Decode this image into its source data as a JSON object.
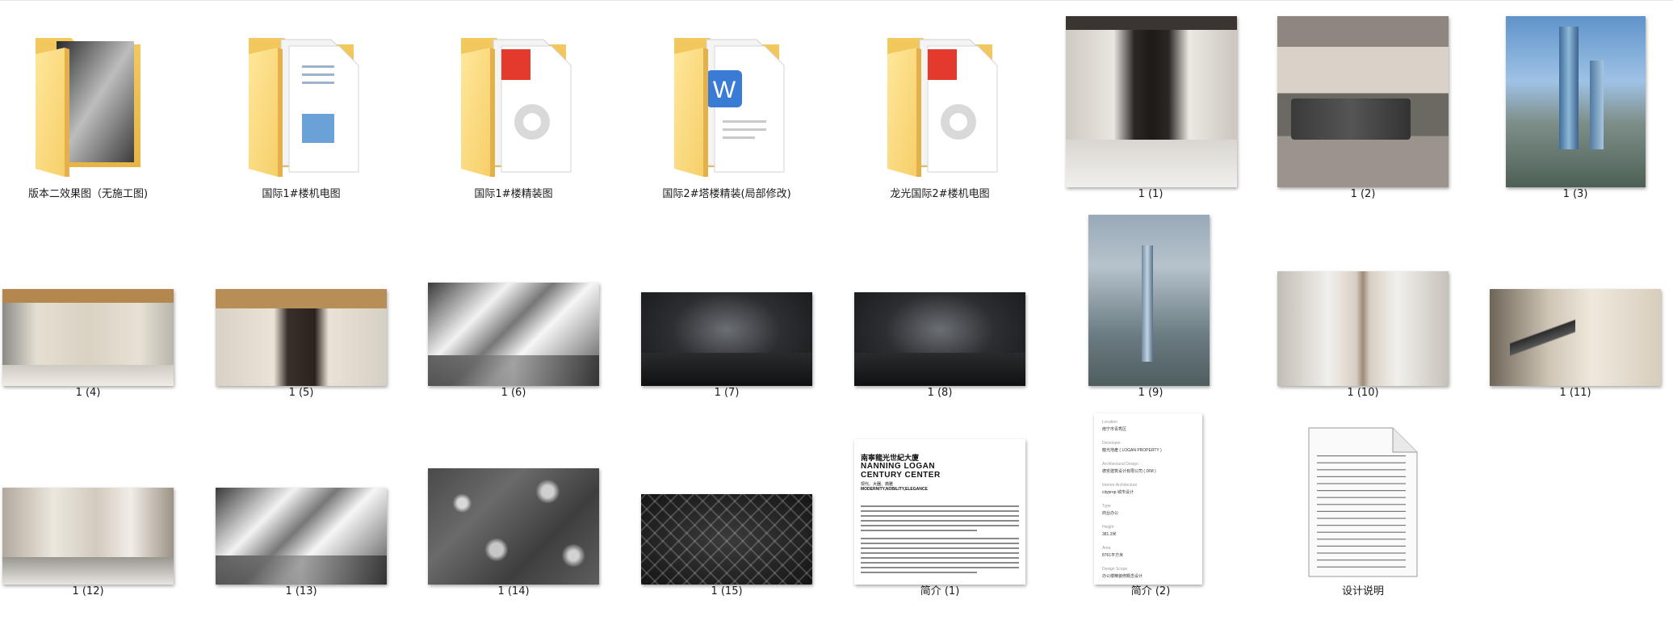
{
  "items": [
    {
      "label": "版本二效果图（无施工图)",
      "kind": "folder",
      "preview": "photo"
    },
    {
      "label": "国际1#楼机电图",
      "kind": "folder",
      "preview": "doc-blue"
    },
    {
      "label": "国际1#楼精装图",
      "kind": "folder",
      "preview": "pdf"
    },
    {
      "label": "国际2#塔楼精装(局部修改)",
      "kind": "folder",
      "preview": "word"
    },
    {
      "label": "龙光国际2#楼机电图",
      "kind": "folder",
      "preview": "pdf"
    },
    {
      "label": "1 (1)",
      "kind": "image",
      "texture": "lobby-elev"
    },
    {
      "label": "1 (2)",
      "kind": "image",
      "texture": "lounge"
    },
    {
      "label": "1 (3)",
      "kind": "image",
      "texture": "tower-aerial"
    },
    {
      "label": "1 (4)",
      "kind": "image",
      "texture": "corridor-gold"
    },
    {
      "label": "1 (5)",
      "kind": "image",
      "texture": "corridor-dark"
    },
    {
      "label": "1 (6)",
      "kind": "image",
      "texture": "skylight"
    },
    {
      "label": "1 (7)",
      "kind": "image",
      "texture": "night"
    },
    {
      "label": "1 (8)",
      "kind": "image",
      "texture": "night"
    },
    {
      "label": "1 (9)",
      "kind": "image",
      "texture": "tower-city"
    },
    {
      "label": "1 (10)",
      "kind": "image",
      "texture": "hall-white"
    },
    {
      "label": "1 (11)",
      "kind": "image",
      "texture": "escalator"
    },
    {
      "label": "1 (12)",
      "kind": "image",
      "texture": "atrium"
    },
    {
      "label": "1 (13)",
      "kind": "image",
      "texture": "skylight"
    },
    {
      "label": "1 (14)",
      "kind": "image",
      "texture": "satellite"
    },
    {
      "label": "1 (15)",
      "kind": "image",
      "texture": "pattern"
    },
    {
      "label": "简介 (1)",
      "kind": "doc"
    },
    {
      "label": "简介 (2)",
      "kind": "spec"
    },
    {
      "label": "设计说明",
      "kind": "text-file"
    }
  ],
  "doc_preview": {
    "title_cn": "南寧龍光世紀大廈",
    "title_en_1": "NANNING LOGAN",
    "title_en_2": "CENTURY CENTER",
    "sub_cn": "现代、大器、典雅",
    "sub_en": "MODERNITY,NOBILITY,ELEGANCE"
  },
  "spec_preview": [
    {
      "k": "Location",
      "v": "南宁市青秀区"
    },
    {
      "k": "Developer",
      "v": "龍光地產 ( LOGAN PROPERTY )"
    },
    {
      "k": "Architectural Design",
      "v": "德安建筑设计有限公司 ( DIM )"
    },
    {
      "k": "Interior Architecture",
      "v": "cityprop 城市设计"
    },
    {
      "k": "Type",
      "v": "商业办公"
    },
    {
      "k": "Height",
      "v": "381.3米"
    },
    {
      "k": "Area",
      "v": "8761平方米"
    },
    {
      "k": "Design Scope",
      "v": "办公楼精装修概念设计"
    }
  ]
}
